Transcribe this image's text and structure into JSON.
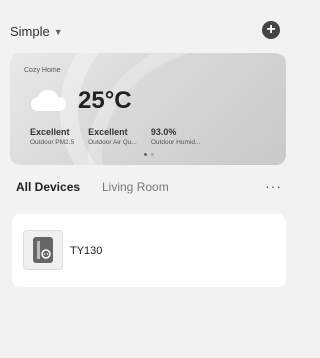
{
  "header": {
    "home_label": "Simple",
    "add_label": "+"
  },
  "weather": {
    "home_name": "Cozy Home",
    "temperature": "25°C",
    "metrics": [
      {
        "value": "Excellent",
        "label": "Outdoor PM2.5"
      },
      {
        "value": "Excellent",
        "label": "Outdoor Air Qu..."
      },
      {
        "value": "93.0%",
        "label": "Outdoor Humid..."
      }
    ],
    "page_dots": 2,
    "active_dot": 0
  },
  "tabs": [
    {
      "label": "All Devices",
      "active": true
    },
    {
      "label": "Living Room",
      "active": false
    }
  ],
  "more_label": "···",
  "devices": [
    {
      "name": "TY130",
      "icon": "smart-plug-icon"
    }
  ]
}
